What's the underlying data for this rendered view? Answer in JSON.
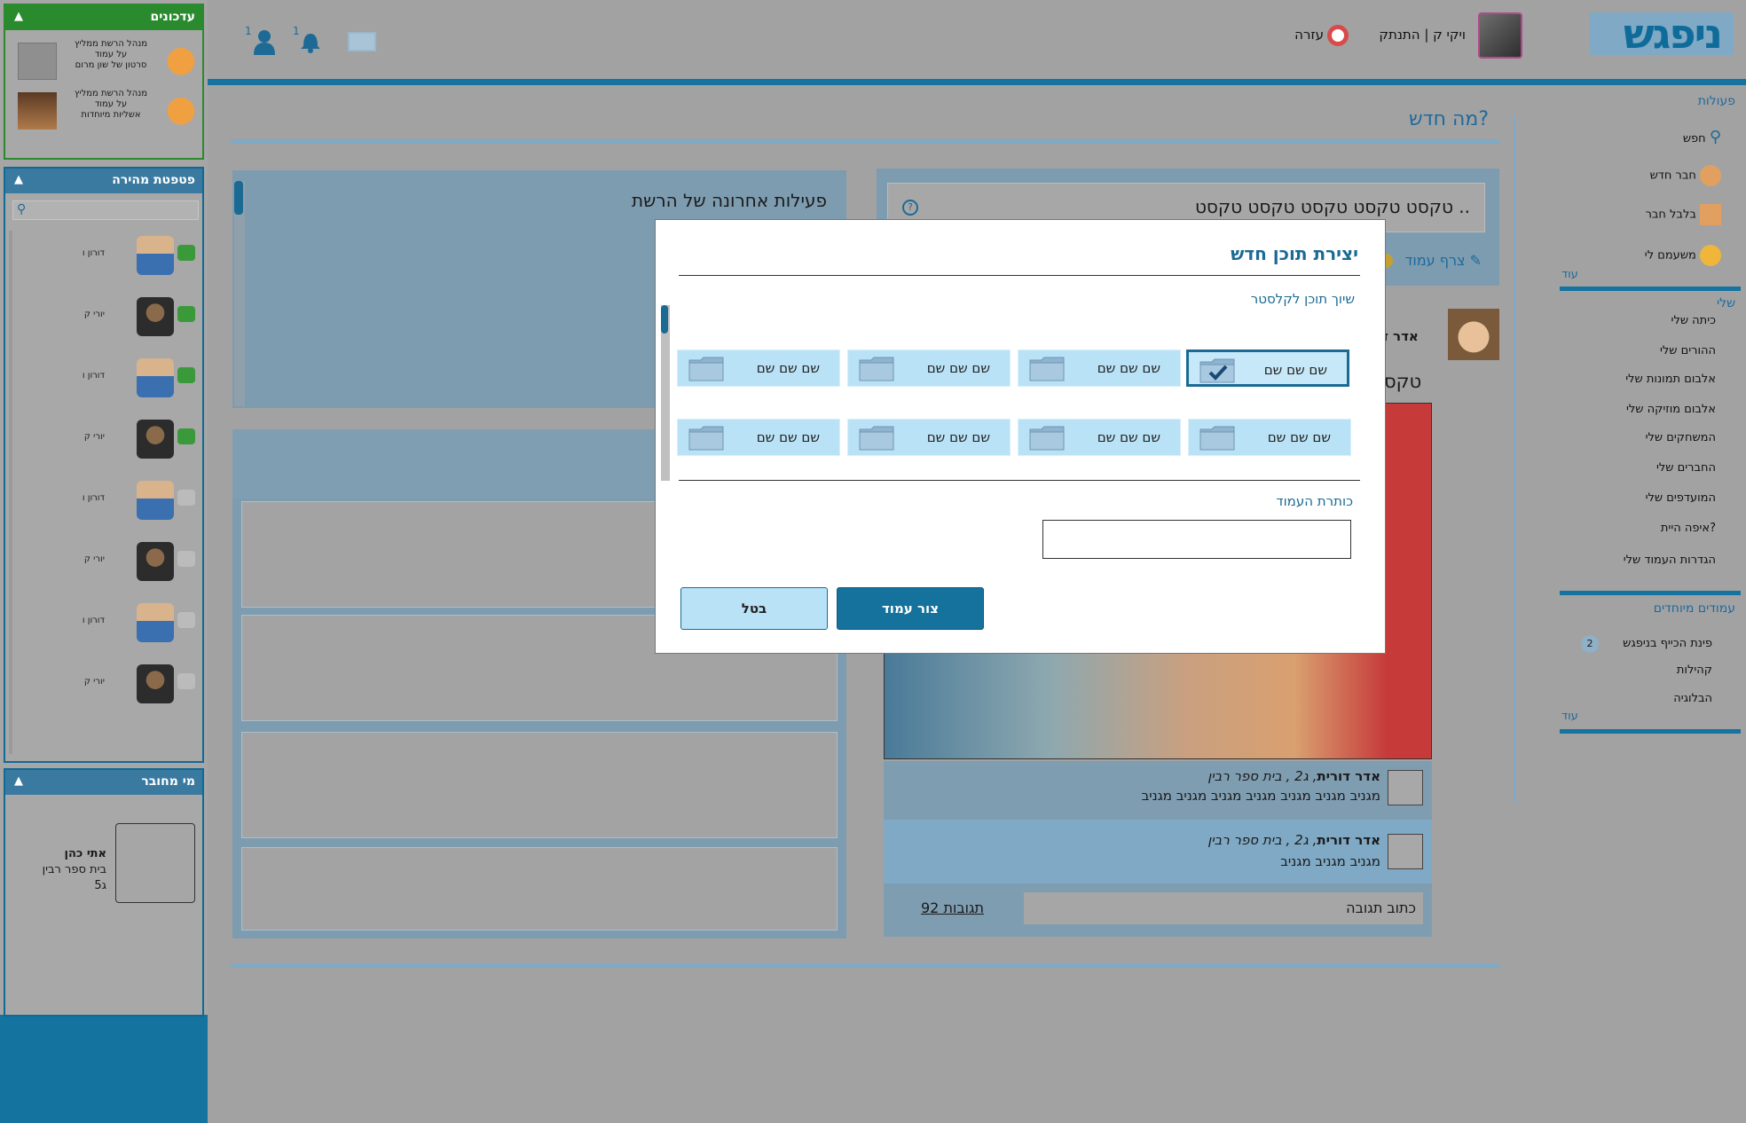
{
  "app": {
    "logo": "ניפגש"
  },
  "header": {
    "user_link": "ויקי ק | התנתק",
    "help": "עזרה",
    "friend_badge": "1",
    "bell_badge": "1"
  },
  "updates": {
    "title": "עדכונים",
    "items": [
      {
        "line1": "מנהל הרשת ממליץ",
        "line2": "על עמוד",
        "line3": "סרטון של שון מרום"
      },
      {
        "line1": "מנהל הרשת ממליץ",
        "line2": "על עמוד",
        "line3": "אשליות מיוחדות"
      }
    ]
  },
  "chat": {
    "title": "פטפטת מהירה",
    "search_placeholder": "",
    "contacts": [
      {
        "name": "דורון ו",
        "online": true
      },
      {
        "name": "יורי ק",
        "online": true
      },
      {
        "name": "דורון ו",
        "online": true
      },
      {
        "name": "יורי ק",
        "online": true
      },
      {
        "name": "דורון ו",
        "online": false
      },
      {
        "name": "יורי ק",
        "online": false
      },
      {
        "name": "דורון ו",
        "online": false
      },
      {
        "name": "יורי ק",
        "online": false
      }
    ]
  },
  "connected": {
    "title": "מי מחובר",
    "name": "אתי כהן",
    "school": "בית ספר רבין",
    "grade": "ג5"
  },
  "nav": {
    "actions_title": "פעולות",
    "actions": [
      "חפש",
      "חבר חדש",
      "בלבל חבר",
      "משעמם לי"
    ],
    "more": "עוד",
    "mine_title": "שלי",
    "mine": [
      "כיתה שלי",
      "ההורים שלי",
      "אלבום תמונות שלי",
      "אלבום מוזיקה שלי",
      "המשחקים שלי",
      "החברים שלי",
      "המועדפים שלי",
      "איפה היית?",
      "הגדרות העמוד שלי"
    ],
    "special_title": "עמודים מיוחדים",
    "special": [
      "פינת הכייף בניפגש",
      "קהילות",
      "הבלוגיה"
    ],
    "special_badge": "2",
    "more2": "עוד"
  },
  "main": {
    "title": "מה חדש?",
    "post_input": "טקסט טקסט טקסט טקסט טקסט ..",
    "attach_label": "צרף עמוד",
    "recent_title": "פעילות אחרונה של הרשת",
    "author_preview": "אדר ד",
    "text_preview": "טקס",
    "comments": [
      {
        "name": "אדר דורית",
        "meta": ", ג2 , בית ספר רבין",
        "text": "מגניב מגניב מגניב מגניב מגניב מגניב מגניב"
      },
      {
        "name": "אדר דורית",
        "meta": ", ג2 , בית ספר רבין",
        "text": "מגניב מגניב מגניב"
      }
    ],
    "reply_placeholder": "כתוב תגובה",
    "replies_count": "92 תגובות"
  },
  "modal": {
    "title": "יצירת תוכן חדש",
    "cluster_label": "שיוך תוכן לקלסטר",
    "folders": [
      "שם שם שם",
      "שם שם שם",
      "שם שם שם",
      "שם שם שם",
      "שם שם שם",
      "שם שם שם",
      "שם שם שם",
      "שם שם שם"
    ],
    "page_title_label": "כותרת העמוד",
    "page_title_value": "",
    "create_button": "צור עמוד",
    "cancel_button": "בטל"
  },
  "colors": {
    "accent": "#14739f",
    "modal_primary": "#1a6a94",
    "folder_bg": "#b9e2f6"
  }
}
